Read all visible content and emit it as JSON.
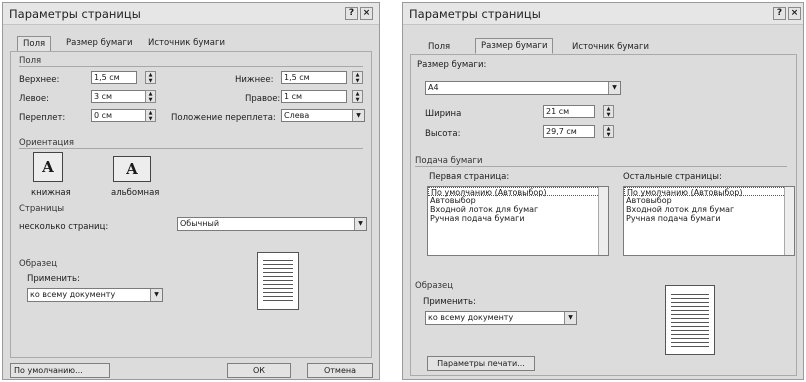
{
  "dialog1": {
    "title": "Параметры страницы",
    "help": "?",
    "close": "×",
    "tabs": [
      "Поля",
      "Размер бумаги",
      "Источник бумаги"
    ],
    "margins_group": "Поля",
    "top_label": "Верхнее:",
    "top_value": "1,5 см",
    "bottom_label": "Нижнее:",
    "bottom_value": "1,5 см",
    "left_label": "Левое:",
    "left_value": "3 см",
    "right_label": "Правое:",
    "right_value": "1 см",
    "gutter_label": "Переплет:",
    "gutter_value": "0 см",
    "gutter_pos_label": "Положение переплета:",
    "gutter_pos_value": "Слева",
    "orientation_group": "Ориентация",
    "portrait": "книжная",
    "landscape": "альбомная",
    "pages_group": "Страницы",
    "multiple_pages_label": "несколько страниц:",
    "multiple_pages_value": "Обычный",
    "sample_group": "Образец",
    "apply_label": "Применить:",
    "apply_value": "ко всему документу",
    "default_button": "По умолчанию...",
    "ok_button": "ОК",
    "cancel_button": "Отмена"
  },
  "dialog2": {
    "title": "Параметры страницы",
    "help": "?",
    "close": "×",
    "tabs": [
      "Поля",
      "Размер бумаги",
      "Источник бумаги"
    ],
    "paper_size_label": "Размер бумаги:",
    "paper_size_value": "A4",
    "width_label": "Ширина",
    "width_value": "21 см",
    "height_label": "Высота:",
    "height_value": "29,7 см",
    "paper_source_group": "Подача бумаги",
    "first_page_label": "Первая страница:",
    "other_pages_label": "Остальные страницы:",
    "source_items": [
      "По умолчанию (Автовыбор)",
      "Автовыбор",
      "Входной лоток для бумаг",
      "Ручная подача бумаги"
    ],
    "sample_group": "Образец",
    "apply_label": "Применить:",
    "apply_value": "ко всему документу",
    "print_options_button": "Параметры печати..."
  }
}
